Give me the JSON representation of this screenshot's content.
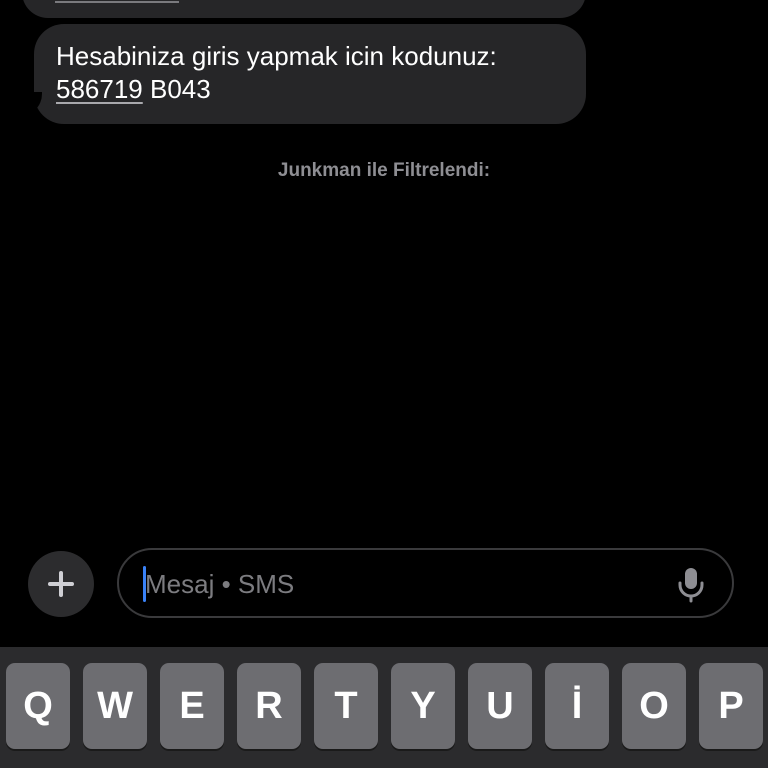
{
  "conversation": {
    "message_text": "Hesabiniza giris yapmak icin kodunuz:",
    "code_link": "586719",
    "code_suffix": "B043",
    "filter_label": "Junkman ile Filtrelendi:"
  },
  "composer": {
    "placeholder": "Mesaj • SMS",
    "add_icon": "plus-icon",
    "mic_icon": "microphone-icon"
  },
  "keyboard": {
    "keys": [
      "Q",
      "W",
      "E",
      "R",
      "T",
      "Y",
      "U",
      "İ",
      "O",
      "P"
    ]
  },
  "colors": {
    "background": "#000000",
    "bubble": "#262628",
    "cursor": "#3a82f7",
    "key": "#6d6d71"
  }
}
